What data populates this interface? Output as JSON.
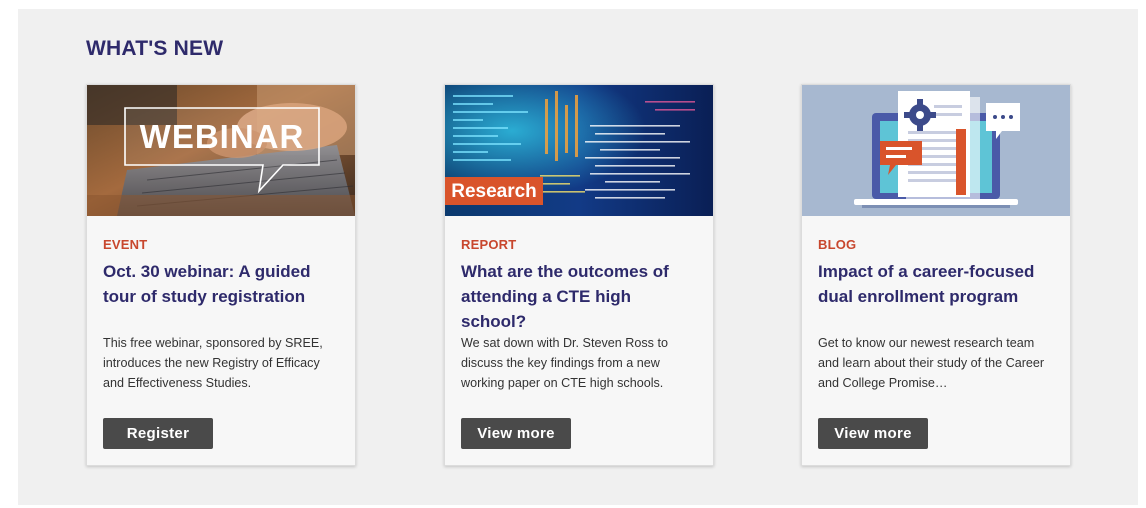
{
  "section": {
    "title": "WHAT'S NEW"
  },
  "cards": [
    {
      "image_text": "WEBINAR",
      "category": "EVENT",
      "title": "Oct. 30 webinar: A guided tour of study registration",
      "description": "This free webinar, sponsored by SREE, introduces the new Registry of Efficacy and Effectiveness Studies.",
      "button_label": "Register"
    },
    {
      "image_text": "Research",
      "category": "REPORT",
      "title": "What are the outcomes of attending a CTE high school?",
      "description": "We sat down with Dr. Steven Ross to discuss the key findings from a new working paper on CTE high schools.",
      "button_label": "View more"
    },
    {
      "image_text": "",
      "category": "BLOG",
      "title": "Impact of a career-focused dual enrollment program",
      "description": "Get to know our newest research team and learn about their study of the Career and College Promise…",
      "button_label": "View more"
    }
  ],
  "colors": {
    "title": "#2e2a6b",
    "category": "#c8472e",
    "button_bg": "#4a4a4a",
    "section_bg": "#f0f0f0"
  }
}
